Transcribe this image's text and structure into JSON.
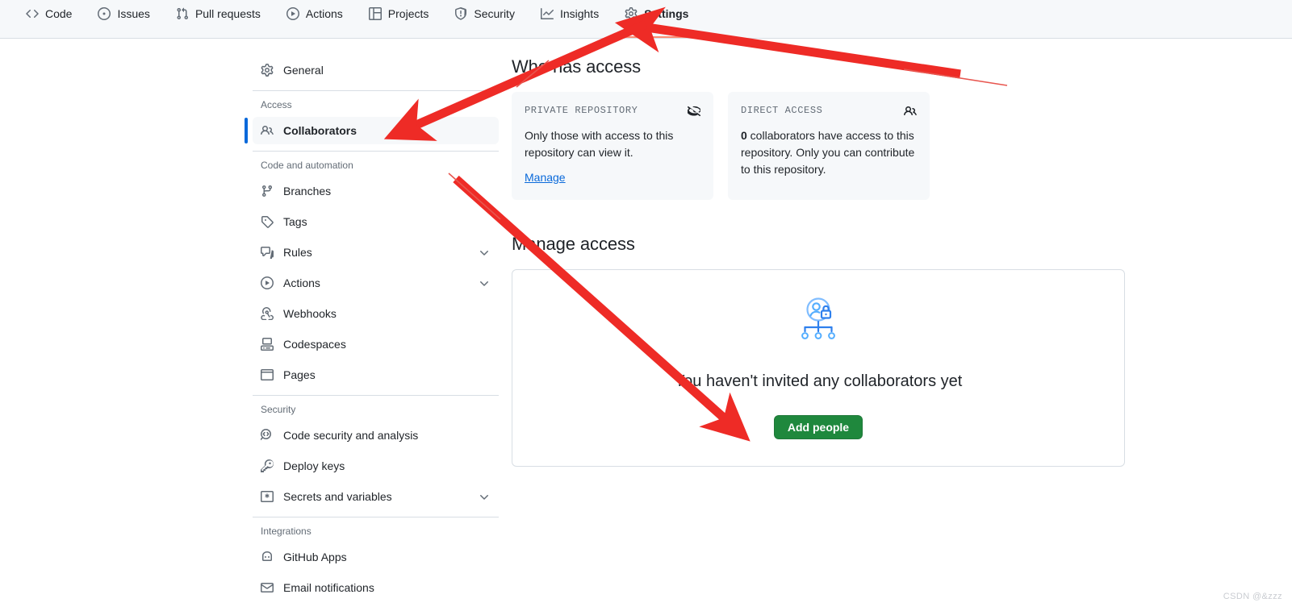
{
  "repo_nav": {
    "tabs": [
      {
        "label": "Code",
        "icon": "code-icon",
        "selected": false
      },
      {
        "label": "Issues",
        "icon": "issue-opened-icon",
        "selected": false
      },
      {
        "label": "Pull requests",
        "icon": "git-pull-request-icon",
        "selected": false
      },
      {
        "label": "Actions",
        "icon": "play-icon",
        "selected": false
      },
      {
        "label": "Projects",
        "icon": "table-icon",
        "selected": false
      },
      {
        "label": "Security",
        "icon": "shield-icon",
        "selected": false
      },
      {
        "label": "Insights",
        "icon": "graph-icon",
        "selected": false
      },
      {
        "label": "Settings",
        "icon": "gear-icon",
        "selected": true
      }
    ]
  },
  "sidebar": {
    "general": {
      "label": "General",
      "icon": "gear-icon"
    },
    "groups": [
      {
        "title": "Access",
        "items": [
          {
            "label": "Collaborators",
            "icon": "people-icon",
            "active": true,
            "expandable": false
          }
        ]
      },
      {
        "title": "Code and automation",
        "items": [
          {
            "label": "Branches",
            "icon": "git-branch-icon",
            "active": false,
            "expandable": false
          },
          {
            "label": "Tags",
            "icon": "tag-icon",
            "active": false,
            "expandable": false
          },
          {
            "label": "Rules",
            "icon": "rules-icon",
            "active": false,
            "expandable": true
          },
          {
            "label": "Actions",
            "icon": "play-icon",
            "active": false,
            "expandable": true
          },
          {
            "label": "Webhooks",
            "icon": "webhook-icon",
            "active": false,
            "expandable": false
          },
          {
            "label": "Codespaces",
            "icon": "codespaces-icon",
            "active": false,
            "expandable": false
          },
          {
            "label": "Pages",
            "icon": "browser-icon",
            "active": false,
            "expandable": false
          }
        ]
      },
      {
        "title": "Security",
        "items": [
          {
            "label": "Code security and analysis",
            "icon": "codescan-icon",
            "active": false,
            "expandable": false
          },
          {
            "label": "Deploy keys",
            "icon": "key-icon",
            "active": false,
            "expandable": false
          },
          {
            "label": "Secrets and variables",
            "icon": "secrets-icon",
            "active": false,
            "expandable": true
          }
        ]
      },
      {
        "title": "Integrations",
        "items": [
          {
            "label": "GitHub Apps",
            "icon": "apps-icon",
            "active": false,
            "expandable": false
          },
          {
            "label": "Email notifications",
            "icon": "mail-icon",
            "active": false,
            "expandable": false
          }
        ]
      }
    ]
  },
  "main": {
    "who_has_access_title": "Who has access",
    "cards": [
      {
        "kicker": "PRIVATE REPOSITORY",
        "icon": "eye-closed-icon",
        "body_prefix": "",
        "body_bold": "",
        "body": "Only those with access to this repository can view it.",
        "link": "Manage"
      },
      {
        "kicker": "DIRECT ACCESS",
        "icon": "people-icon",
        "body_bold": "0",
        "body": " collaborators have access to this repository. Only you can contribute to this repository.",
        "link": ""
      }
    ],
    "manage_access_title": "Manage access",
    "empty_state": {
      "illustration": "locked-user-hierarchy-icon",
      "title": "You haven't invited any collaborators yet",
      "button_label": "Add people"
    }
  },
  "annotations": {
    "arrow_color": "#ee2b26",
    "thin_line_color": "#e8564f"
  },
  "watermark": "CSDN @&zzz",
  "colors": {
    "accent_blue": "#0969da",
    "success_green": "#1f883d",
    "tab_underline": "#fd8c73",
    "muted": "#636c76",
    "border": "#d8dee4",
    "canvas_subtle": "#f6f8fa"
  }
}
